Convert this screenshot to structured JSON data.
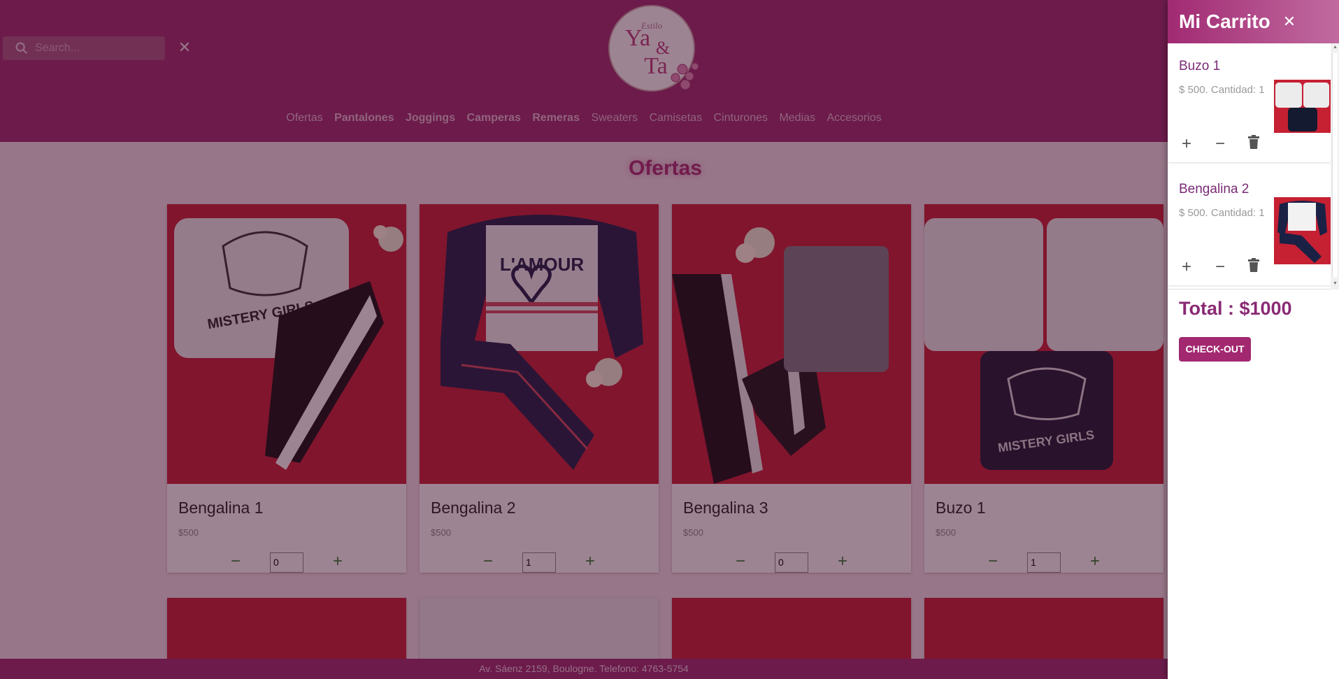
{
  "header": {
    "search": {
      "placeholder": "Search..."
    },
    "logo": {
      "line1": "Estilo",
      "line2": "Ya",
      "line3": "&",
      "line4": "Ta"
    },
    "nav": [
      {
        "label": "Ofertas",
        "bold": false
      },
      {
        "label": "Pantalones",
        "bold": true
      },
      {
        "label": "Joggings",
        "bold": true
      },
      {
        "label": "Camperas",
        "bold": true
      },
      {
        "label": "Remeras",
        "bold": true
      },
      {
        "label": "Sweaters",
        "bold": false
      },
      {
        "label": "Camisetas",
        "bold": false
      },
      {
        "label": "Cinturones",
        "bold": false
      },
      {
        "label": "Medias",
        "bold": false
      },
      {
        "label": "Accesorios",
        "bold": false
      }
    ]
  },
  "main": {
    "title": "Ofertas",
    "products": [
      {
        "name": "Bengalina 1",
        "price": "$500",
        "qty": "0",
        "image_text": "MISTERY GIRLS"
      },
      {
        "name": "Bengalina 2",
        "price": "$500",
        "qty": "1",
        "image_text": "L'AMOUR"
      },
      {
        "name": "Bengalina 3",
        "price": "$500",
        "qty": "0",
        "image_text": ""
      },
      {
        "name": "Buzo 1",
        "price": "$500",
        "qty": "1",
        "image_text": "MISTERY GIRLS"
      }
    ]
  },
  "footer": {
    "text": "Av. Sáenz 2159, Boulogne. Telefono: 4763-5754"
  },
  "cart": {
    "title": "Mi Carrito",
    "items": [
      {
        "name": "Buzo 1",
        "desc": "$ 500. Cantidad: 1"
      },
      {
        "name": "Bengalina 2",
        "desc": "$ 500. Cantidad: 1"
      }
    ],
    "total": "Total : $1000",
    "checkout_label": "CHECK-OUT"
  },
  "colors": {
    "brand": "#9c2c6e",
    "accent": "#a2286f",
    "qty_green": "#2e7d32"
  }
}
